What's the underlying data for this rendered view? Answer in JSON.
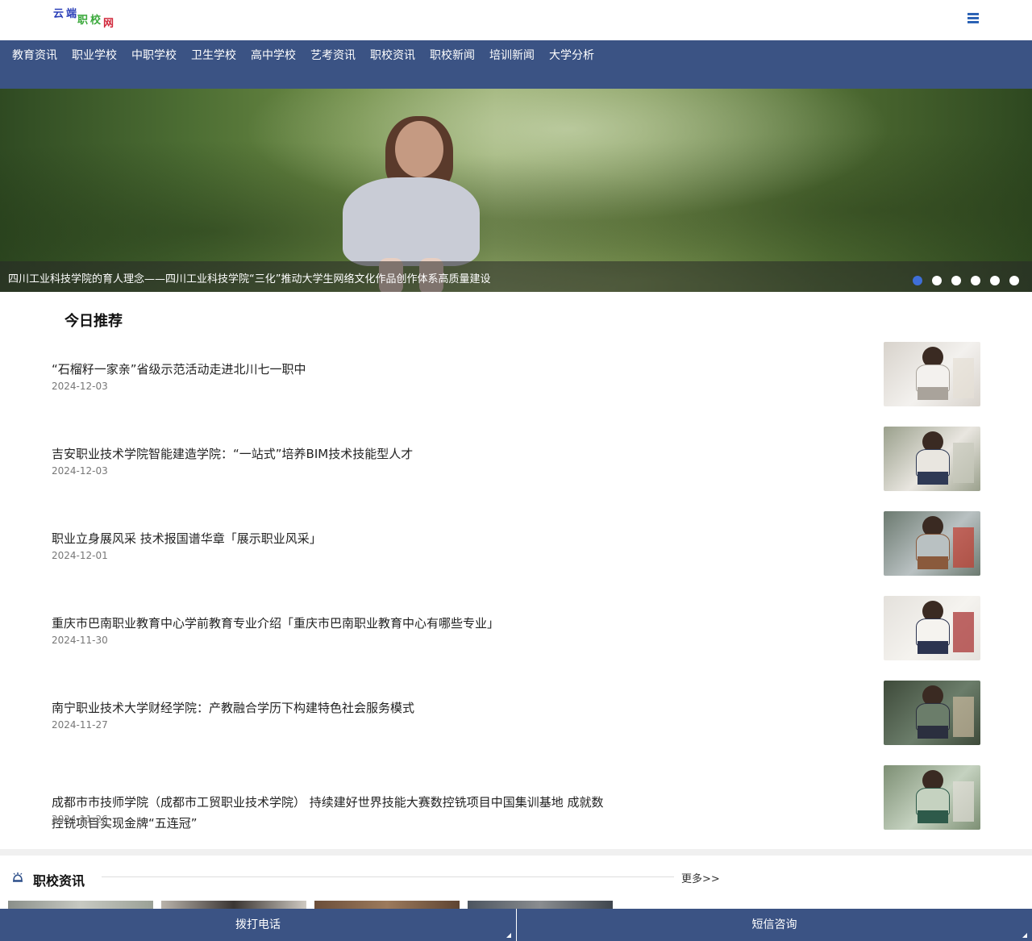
{
  "logo": {
    "chars": [
      "云",
      "端",
      "职",
      "校",
      "网"
    ]
  },
  "nav": {
    "items": [
      "教育资讯",
      "职业学校",
      "中职学校",
      "卫生学校",
      "高中学校",
      "艺考资讯",
      "职校资讯",
      "职校新闻",
      "培训新闻",
      "大学分析"
    ]
  },
  "banner": {
    "caption": "四川工业科技学院的育人理念——四川工业科技学院“三化”推动大学生网络文化作品创作体系高质量建设",
    "slide_count": 6,
    "active_slide": 1
  },
  "today": {
    "title": "今日推荐",
    "articles": [
      {
        "title": "“石榴籽一家亲”省级示范活动走进北川七一职中",
        "date": "2024-12-03"
      },
      {
        "title": "吉安职业技术学院智能建造学院：“一站式”培养BIM技术技能型人才",
        "date": "2024-12-03"
      },
      {
        "title": "职业立身展风采 技术报国谱华章「展示职业风采」",
        "date": "2024-12-01"
      },
      {
        "title": "重庆市巴南职业教育中心学前教育专业介绍「重庆市巴南职业教育中心有哪些专业」",
        "date": "2024-11-30"
      },
      {
        "title": "南宁职业技术大学财经学院：产教融合学历下构建特色社会服务模式",
        "date": "2024-11-27"
      },
      {
        "title": "成都市市技师学院（成都市工贸职业技术学院） 持续建好世界技能大赛数控铣项目中国集训基地 成就数控铣项目实现金牌“五连冠”",
        "date": "2024-11-26"
      }
    ]
  },
  "zhixiao": {
    "title": "职校资讯",
    "more": "更多>>"
  },
  "bottom_bar": {
    "call": "拨打电话",
    "sms": "短信咨询"
  },
  "colors": {
    "nav_bg": "#3b5384",
    "active_dot": "#3f6fd8",
    "menu_icon": "#2d63b5"
  }
}
